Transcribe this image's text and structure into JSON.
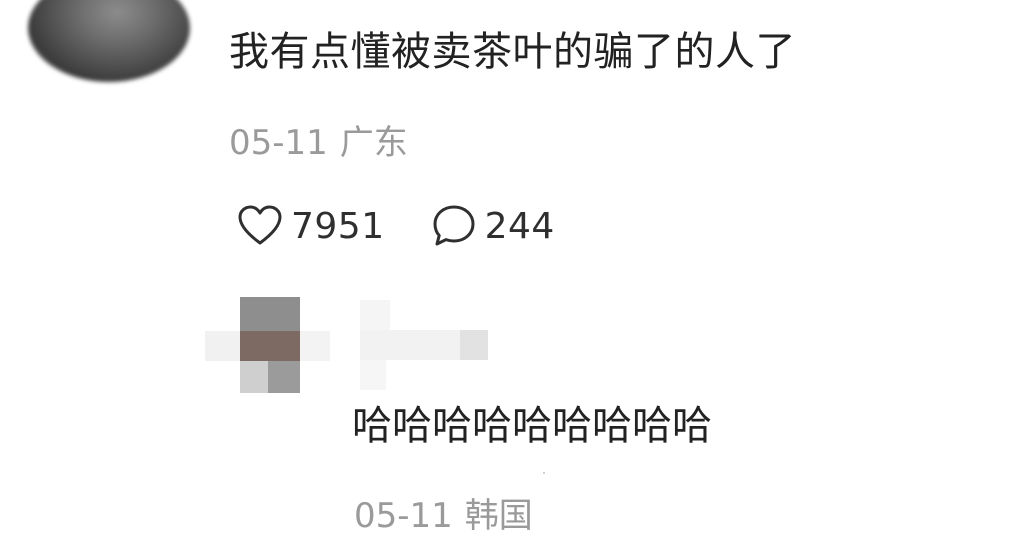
{
  "comment": {
    "text": "我有点懂被卖茶叶的骗了的人了",
    "date": "05-11",
    "location": "广东",
    "likes": "7951",
    "replies": "244",
    "icons": {
      "like": "heart-icon",
      "reply": "speech-bubble-icon"
    }
  },
  "reply": {
    "text": "哈哈哈哈哈哈哈哈哈",
    "date": "05-11",
    "location": "韩国"
  },
  "colors": {
    "text_primary": "#222222",
    "text_meta": "#9a9a9a",
    "icon": "#2f2f2f"
  }
}
